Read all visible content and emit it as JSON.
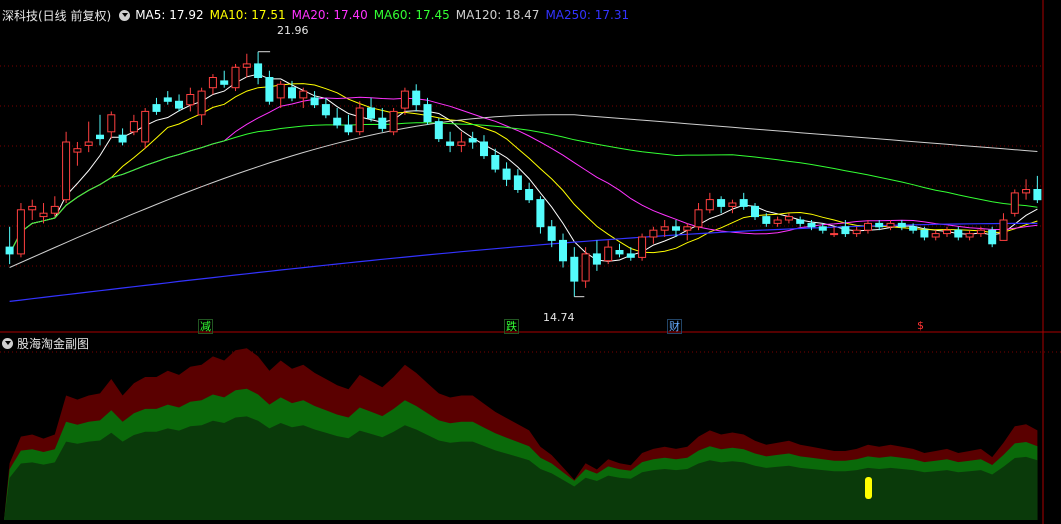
{
  "main_panel": {
    "title": "深科技(日线 前复权)",
    "ma_legend": [
      {
        "label": "MA5: 17.92",
        "color": "#ffffff"
      },
      {
        "label": "MA10: 17.51",
        "color": "#ffff00"
      },
      {
        "label": "MA20: 17.40",
        "color": "#ff33ff"
      },
      {
        "label": "MA60: 17.45",
        "color": "#33ff33"
      },
      {
        "label": "MA120: 18.47",
        "color": "#cfcfcf"
      },
      {
        "label": "MA250: 17.31",
        "color": "#3333ff"
      }
    ],
    "high_label": "21.96",
    "low_label": "14.74",
    "event_markers": [
      {
        "label": "减",
        "color": "#33ff33"
      },
      {
        "label": "跌",
        "color": "#33ff33"
      },
      {
        "label": "财",
        "color": "#66aaff"
      },
      {
        "label": "$",
        "color": "#ff3333"
      }
    ]
  },
  "sub_panel": {
    "title": "股海淘金副图"
  },
  "colors": {
    "background": "#000000",
    "up_candle": "#ff4040",
    "down_candle": "#54fcfc",
    "grid": "#7a0000",
    "outer_area": "#5a0000",
    "mid_area": "#0a6a0a",
    "inner_area": "#0a3a0a",
    "signal": "#ffff00"
  },
  "chart_data": {
    "type": "candlestick",
    "price_axis_range": [
      14.2,
      22.6
    ],
    "ohlc": [
      [
        16.2,
        16.8,
        15.7,
        16.0
      ],
      [
        16.0,
        17.5,
        15.9,
        17.3
      ],
      [
        17.3,
        17.6,
        17.0,
        17.4
      ],
      [
        17.1,
        17.5,
        16.9,
        17.2
      ],
      [
        17.2,
        17.7,
        17.1,
        17.4
      ],
      [
        17.6,
        19.6,
        17.5,
        19.3
      ],
      [
        19.0,
        19.3,
        18.6,
        19.1
      ],
      [
        19.2,
        19.9,
        19.0,
        19.3
      ],
      [
        19.5,
        20.1,
        19.2,
        19.4
      ],
      [
        19.6,
        20.2,
        19.4,
        20.1
      ],
      [
        19.5,
        19.7,
        19.2,
        19.3
      ],
      [
        19.6,
        20.1,
        19.5,
        19.9
      ],
      [
        19.3,
        20.3,
        19.1,
        20.2
      ],
      [
        20.4,
        20.6,
        20.1,
        20.2
      ],
      [
        20.6,
        20.8,
        20.4,
        20.5
      ],
      [
        20.5,
        20.7,
        20.2,
        20.3
      ],
      [
        20.4,
        20.9,
        20.2,
        20.7
      ],
      [
        20.1,
        20.9,
        19.8,
        20.8
      ],
      [
        20.9,
        21.3,
        20.7,
        21.2
      ],
      [
        21.1,
        21.4,
        20.9,
        21.0
      ],
      [
        20.9,
        21.6,
        20.8,
        21.5
      ],
      [
        21.5,
        21.9,
        21.2,
        21.6
      ],
      [
        21.6,
        21.96,
        21.0,
        21.2
      ],
      [
        21.2,
        21.4,
        20.4,
        20.5
      ],
      [
        20.6,
        21.1,
        20.3,
        21.0
      ],
      [
        20.9,
        21.1,
        20.5,
        20.6
      ],
      [
        20.6,
        20.9,
        20.3,
        20.8
      ],
      [
        20.6,
        20.8,
        20.3,
        20.4
      ],
      [
        20.4,
        20.6,
        20.0,
        20.1
      ],
      [
        20.0,
        20.3,
        19.7,
        19.8
      ],
      [
        19.8,
        20.1,
        19.5,
        19.6
      ],
      [
        19.6,
        20.5,
        19.5,
        20.3
      ],
      [
        20.3,
        20.6,
        19.9,
        20.0
      ],
      [
        20.0,
        20.3,
        19.6,
        19.7
      ],
      [
        19.6,
        20.3,
        19.5,
        20.2
      ],
      [
        20.3,
        20.9,
        20.1,
        20.8
      ],
      [
        20.8,
        21.0,
        20.2,
        20.4
      ],
      [
        20.4,
        20.6,
        19.8,
        19.9
      ],
      [
        19.9,
        20.0,
        19.3,
        19.4
      ],
      [
        19.3,
        19.6,
        19.0,
        19.2
      ],
      [
        19.2,
        19.6,
        19.0,
        19.3
      ],
      [
        19.4,
        19.6,
        19.1,
        19.3
      ],
      [
        19.3,
        19.5,
        18.8,
        18.9
      ],
      [
        18.9,
        19.1,
        18.4,
        18.5
      ],
      [
        18.5,
        18.7,
        18.0,
        18.2
      ],
      [
        18.3,
        18.5,
        17.8,
        17.9
      ],
      [
        17.9,
        18.1,
        17.5,
        17.6
      ],
      [
        17.6,
        17.7,
        16.6,
        16.8
      ],
      [
        16.8,
        17.0,
        16.2,
        16.4
      ],
      [
        16.4,
        16.6,
        15.6,
        15.8
      ],
      [
        15.9,
        16.2,
        14.74,
        15.2
      ],
      [
        15.2,
        16.2,
        15.0,
        16.0
      ],
      [
        16.0,
        16.4,
        15.5,
        15.7
      ],
      [
        15.8,
        16.4,
        15.7,
        16.2
      ],
      [
        16.1,
        16.3,
        15.9,
        16.0
      ],
      [
        16.0,
        16.2,
        15.8,
        15.9
      ],
      [
        15.9,
        16.6,
        15.8,
        16.5
      ],
      [
        16.5,
        16.8,
        16.3,
        16.7
      ],
      [
        16.7,
        17.0,
        16.5,
        16.8
      ],
      [
        16.8,
        17.0,
        16.5,
        16.7
      ],
      [
        16.7,
        16.9,
        16.4,
        16.8
      ],
      [
        16.8,
        17.5,
        16.7,
        17.3
      ],
      [
        17.3,
        17.8,
        17.2,
        17.6
      ],
      [
        17.6,
        17.7,
        17.2,
        17.4
      ],
      [
        17.4,
        17.6,
        17.2,
        17.5
      ],
      [
        17.6,
        17.8,
        17.3,
        17.4
      ],
      [
        17.4,
        17.5,
        17.0,
        17.1
      ],
      [
        17.1,
        17.2,
        16.8,
        16.9
      ],
      [
        16.9,
        17.1,
        16.8,
        17.0
      ],
      [
        17.0,
        17.2,
        16.9,
        17.1
      ],
      [
        17.0,
        17.1,
        16.8,
        16.9
      ],
      [
        16.9,
        17.0,
        16.7,
        16.8
      ],
      [
        16.8,
        16.9,
        16.6,
        16.7
      ],
      [
        16.6,
        16.8,
        16.5,
        16.6
      ],
      [
        16.8,
        17.0,
        16.5,
        16.6
      ],
      [
        16.6,
        16.8,
        16.5,
        16.7
      ],
      [
        16.7,
        17.0,
        16.6,
        16.9
      ],
      [
        16.9,
        17.0,
        16.7,
        16.8
      ],
      [
        16.8,
        17.0,
        16.7,
        16.9
      ],
      [
        16.9,
        17.0,
        16.7,
        16.8
      ],
      [
        16.8,
        16.9,
        16.6,
        16.7
      ],
      [
        16.7,
        16.8,
        16.4,
        16.5
      ],
      [
        16.5,
        16.7,
        16.4,
        16.6
      ],
      [
        16.6,
        16.8,
        16.5,
        16.7
      ],
      [
        16.7,
        16.8,
        16.4,
        16.5
      ],
      [
        16.5,
        16.7,
        16.4,
        16.6
      ],
      [
        16.6,
        16.8,
        16.5,
        16.7
      ],
      [
        16.7,
        16.8,
        16.2,
        16.3
      ],
      [
        16.4,
        17.2,
        16.4,
        17.0
      ],
      [
        17.2,
        17.9,
        17.1,
        17.8
      ],
      [
        17.8,
        18.2,
        17.6,
        17.9
      ],
      [
        17.9,
        18.3,
        17.5,
        17.6
      ]
    ],
    "ma_series": [
      "MA5",
      "MA10",
      "MA20",
      "MA60",
      "MA120",
      "MA250"
    ]
  }
}
